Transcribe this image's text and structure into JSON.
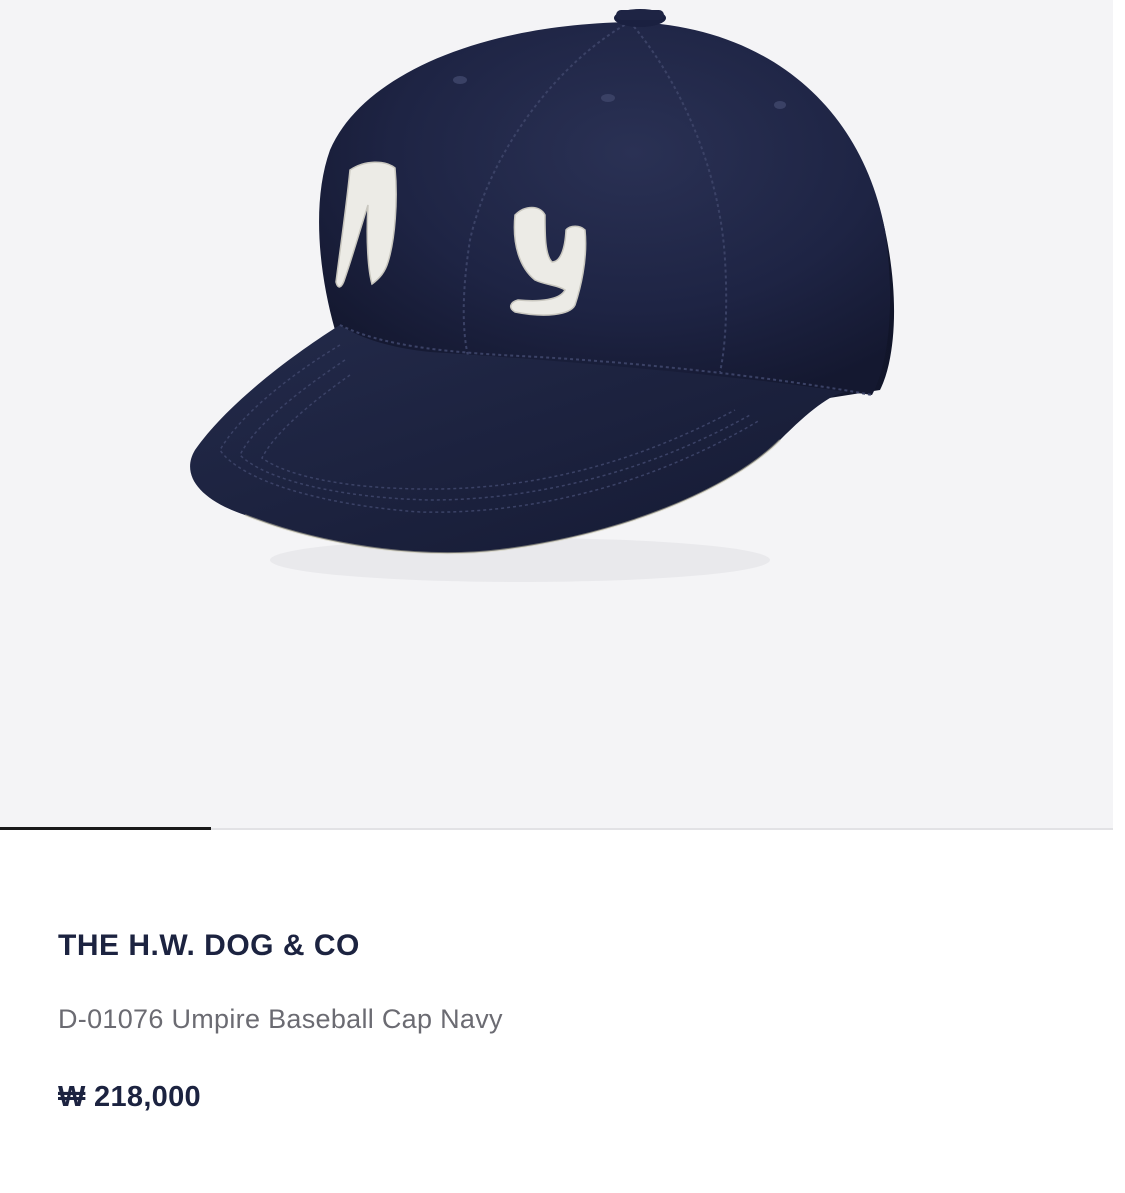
{
  "product": {
    "brand": "THE H.W. DOG & CO",
    "name": "D-01076 Umpire Baseball Cap Navy",
    "price": "₩ 218,000",
    "image_alt": "Navy baseball cap with white NY felt lettering"
  },
  "gallery": {
    "current_index": 1,
    "progress_fraction": 0.19
  },
  "colors": {
    "cap_navy": "#1b2140",
    "lettering": "#ecebe6",
    "brand_text": "#1c2340",
    "name_text": "#6b6b72",
    "image_background": "#f4f4f6"
  }
}
